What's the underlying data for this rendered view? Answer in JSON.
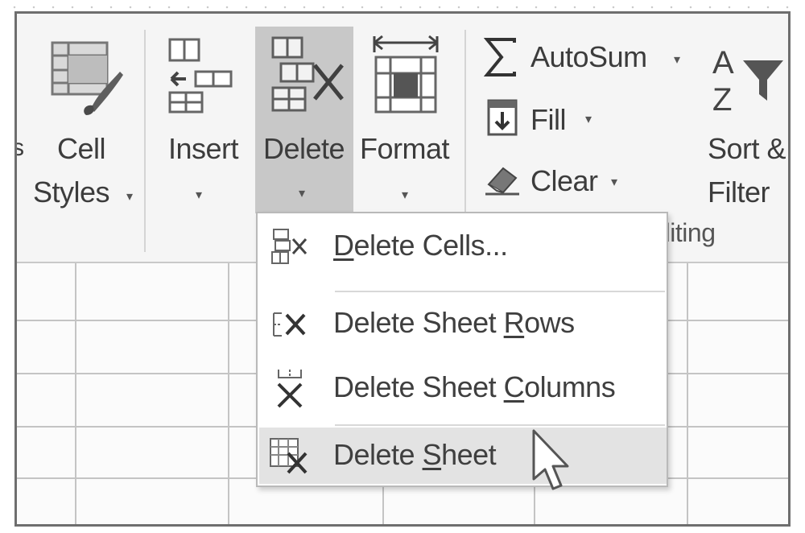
{
  "ribbon": {
    "left_fragment": "s",
    "cell_styles": {
      "line1": "Cell",
      "line2": "Styles",
      "caret": "▾"
    },
    "insert": {
      "label": "Insert",
      "caret": "▾"
    },
    "delete": {
      "label": "Delete",
      "caret": "▾"
    },
    "format": {
      "label": "Format",
      "caret": "▾"
    },
    "autosum": {
      "label": "AutoSum",
      "caret": "▾"
    },
    "fill": {
      "label": "Fill",
      "caret": "▾"
    },
    "clear": {
      "label": "Clear",
      "caret": "▾"
    },
    "sort_filter": {
      "line1": "Sort &",
      "line2": "Filter",
      "caret": "▾"
    },
    "group_label_fragment": "diting"
  },
  "delete_menu": {
    "items": [
      {
        "pre": "",
        "key": "D",
        "post": "elete Cells...",
        "icon": "delete-cells-icon"
      },
      {
        "pre": "Delete Sheet ",
        "key": "R",
        "post": "ows",
        "icon": "delete-rows-icon"
      },
      {
        "pre": "Delete Sheet ",
        "key": "C",
        "post": "olumns",
        "icon": "delete-columns-icon"
      },
      {
        "pre": "Delete ",
        "key": "S",
        "post": "heet",
        "icon": "delete-sheet-icon"
      }
    ],
    "hovered_index": 3
  },
  "colors": {
    "ribbon_bg": "#f5f5f5",
    "pressed_button": "#c8c8c8",
    "menu_hover": "#e3e3e3",
    "text": "#3c3c3c"
  }
}
